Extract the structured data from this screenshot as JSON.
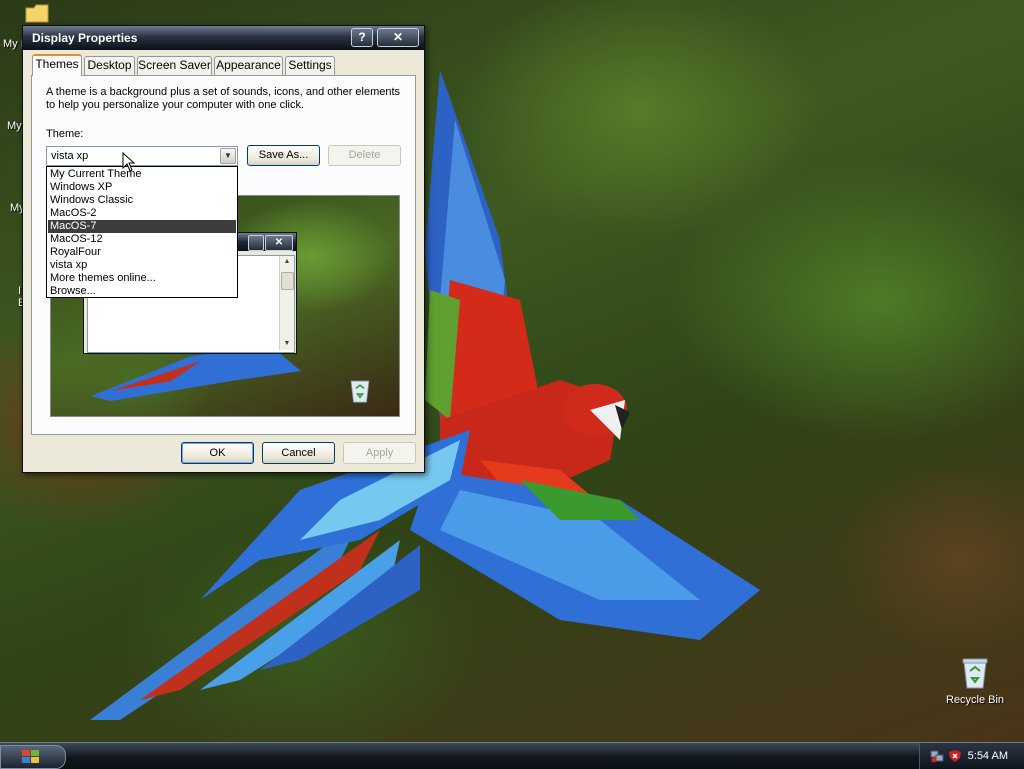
{
  "desktop": {
    "icon_labels": [
      "My I",
      "My",
      "My",
      "I",
      "E"
    ],
    "recycle_bin_label": "Recycle Bin"
  },
  "taskbar": {
    "clock": "5:54 AM",
    "tray_icons": [
      "network-icon",
      "security-shield-icon"
    ]
  },
  "window": {
    "title": "Display Properties",
    "help_glyph": "?",
    "close_glyph": "✕",
    "tabs": [
      {
        "label": "Themes",
        "active": true
      },
      {
        "label": "Desktop",
        "active": false
      },
      {
        "label": "Screen Saver",
        "active": false
      },
      {
        "label": "Appearance",
        "active": false
      },
      {
        "label": "Settings",
        "active": false
      }
    ],
    "intro_text": "A theme is a background plus a set of sounds, icons, and other elements to help you personalize your computer with one click.",
    "theme_label": "Theme:",
    "theme_value": "vista xp",
    "save_as_label": "Save As...",
    "delete_label": "Delete",
    "dropdown_options": [
      "My Current Theme",
      "Windows XP",
      "Windows Classic",
      "MacOS-2",
      "MacOS-7",
      "MacOS-12",
      "RoyalFour",
      "vista xp",
      "More themes online...",
      "Browse..."
    ],
    "dropdown_selected": "MacOS-7",
    "ok_label": "OK",
    "cancel_label": "Cancel",
    "apply_label": "Apply",
    "preview_close_glyph": "✕"
  },
  "colors": {
    "titlebar": "#2a3242",
    "taskbar": "#11161e",
    "selection": "#3d3d3d",
    "tab_highlight": "#e68b2c"
  }
}
